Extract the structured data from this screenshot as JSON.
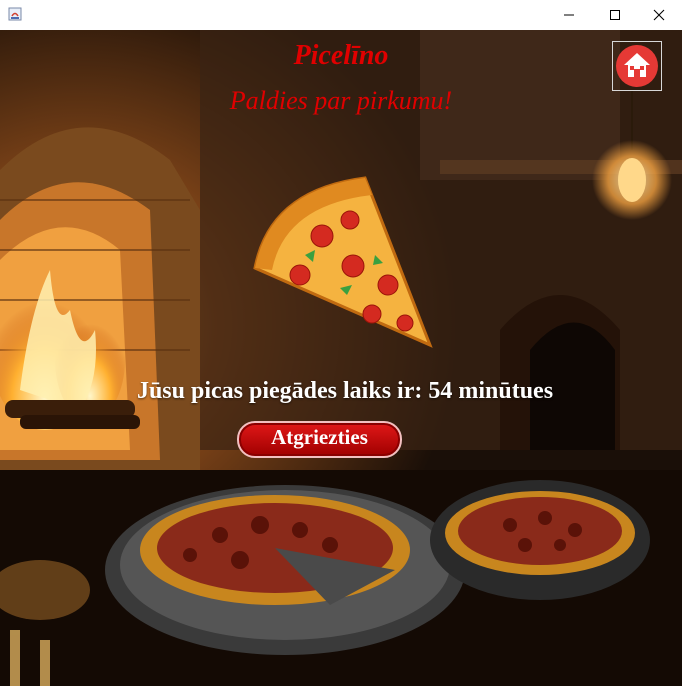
{
  "window": {
    "controls": {
      "minimize_icon": "minimize-icon",
      "maximize_icon": "maximize-icon",
      "close_icon": "close-icon"
    }
  },
  "app": {
    "title": "Picelīno",
    "thanks": "Paldies par pirkumu!",
    "delivery_text": "Jūsu picas piegādes laiks ir: 54 minūtues",
    "return_button": "Atgriezties",
    "home_icon": "home-icon"
  },
  "colors": {
    "title_red": "#e00000",
    "button_red": "#c40000",
    "home_red": "#e53935"
  }
}
